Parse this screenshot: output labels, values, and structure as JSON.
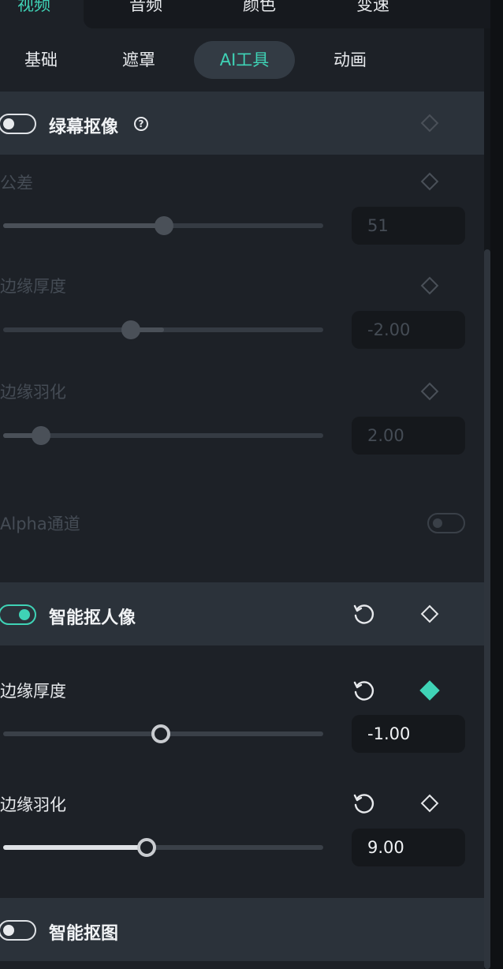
{
  "top_tabs": [
    {
      "label": "视频",
      "active": true
    },
    {
      "label": "音频",
      "active": false
    },
    {
      "label": "颜色",
      "active": false
    },
    {
      "label": "变速",
      "active": false
    }
  ],
  "sub_tabs": [
    {
      "label": "基础",
      "active": false
    },
    {
      "label": "遮罩",
      "active": false
    },
    {
      "label": "AI工具",
      "active": true
    },
    {
      "label": "动画",
      "active": false
    }
  ],
  "chroma_key": {
    "title": "绿幕抠像",
    "enabled": false,
    "help_icon": "question-circle-icon",
    "params": [
      {
        "label": "公差",
        "value": "51",
        "slider": 0.5
      },
      {
        "label": "边缘厚度",
        "value": "-2.00",
        "slider": 0.4
      },
      {
        "label": "边缘羽化",
        "value": "2.00",
        "slider": 0.12
      }
    ],
    "alpha_label": "Alpha通道",
    "alpha_enabled": false
  },
  "ai_portrait": {
    "title": "智能抠人像",
    "enabled": true,
    "params": [
      {
        "label": "边缘厚度",
        "value": "-1.00",
        "slider": 0.49,
        "keyframe_active": true
      },
      {
        "label": "边缘羽化",
        "value": "9.00",
        "slider": 0.45,
        "keyframe_active": false
      }
    ]
  },
  "smart_cutout": {
    "title": "智能抠图",
    "enabled": false
  },
  "colors": {
    "accent": "#3fd3b6",
    "background": "#1d2127",
    "section_bar": "#2b323a",
    "value_box": "#15181c"
  }
}
